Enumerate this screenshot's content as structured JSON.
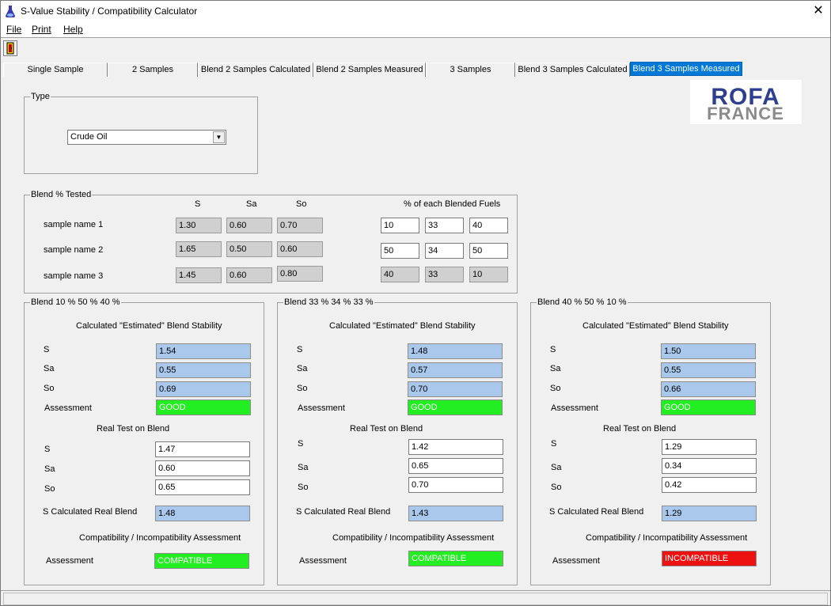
{
  "window": {
    "title": "S-Value Stability / Compatibility Calculator"
  },
  "menu": {
    "file": "File",
    "print": "Print",
    "help": "Help"
  },
  "tabs": [
    {
      "label": "Single Sample"
    },
    {
      "label": "2 Samples"
    },
    {
      "label": "Blend 2 Samples Calculated"
    },
    {
      "label": "Blend 2 Samples Measured"
    },
    {
      "label": "3 Samples"
    },
    {
      "label": "Blend 3 Samples Calculated"
    },
    {
      "label": "Blend 3 Samples Measured"
    }
  ],
  "logo": {
    "line1": "ROFA",
    "line2": "FRANCE"
  },
  "type_group": {
    "title": "Type",
    "selected": "Crude Oil"
  },
  "blend_tested": {
    "title": "Blend % Tested",
    "col_s": "S",
    "col_sa": "Sa",
    "col_so": "So",
    "fuels_header": "% of each Blended Fuels",
    "rows": [
      {
        "name": "sample name 1",
        "s": "1.30",
        "sa": "0.60",
        "so": "0.70",
        "p1": "10",
        "p2": "33",
        "p3": "40"
      },
      {
        "name": "sample name 2",
        "s": "1.65",
        "sa": "0.50",
        "so": "0.60",
        "p1": "50",
        "p2": "34",
        "p3": "50"
      },
      {
        "name": "sample name 3",
        "s": "1.45",
        "sa": "0.60",
        "so": "0.80",
        "p1": "40",
        "p2": "33",
        "p3": "10"
      }
    ]
  },
  "blends": [
    {
      "title": "Blend 10 % 50 % 40 %",
      "calc_header": "Calculated \"Estimated\" Blend Stability",
      "s_label": "S",
      "sa_label": "Sa",
      "so_label": "So",
      "assess_label": "Assessment",
      "calc_s": "1.54",
      "calc_sa": "0.55",
      "calc_so": "0.69",
      "calc_assessment": "GOOD",
      "real_header": "Real Test on Blend",
      "real_s": "1.47",
      "real_sa": "0.60",
      "real_so": "0.65",
      "s_calc_real_label": "S Calculated Real Blend",
      "s_calc_real": "1.48",
      "compat_header": "Compatibility / Incompatibility Assessment",
      "compat_assessment": "COMPATIBLE"
    },
    {
      "title": "Blend 33 % 34 % 33 %",
      "calc_header": "Calculated \"Estimated\" Blend Stability",
      "s_label": "S",
      "sa_label": "Sa",
      "so_label": "So",
      "assess_label": "Assessment",
      "calc_s": "1.48",
      "calc_sa": "0.57",
      "calc_so": "0.70",
      "calc_assessment": "GOOD",
      "real_header": "Real Test on Blend",
      "real_s": "1.42",
      "real_sa": "0.65",
      "real_so": "0.70",
      "s_calc_real_label": "S Calculated Real Blend",
      "s_calc_real": "1.43",
      "compat_header": "Compatibility / Incompatibility Assessment",
      "compat_assessment": "COMPATIBLE"
    },
    {
      "title": "Blend 40 % 50 % 10 %",
      "calc_header": "Calculated \"Estimated\" Blend Stability",
      "s_label": "S",
      "sa_label": "Sa",
      "so_label": "So",
      "assess_label": "Assessment",
      "calc_s": "1.50",
      "calc_sa": "0.55",
      "calc_so": "0.66",
      "calc_assessment": "GOOD",
      "real_header": "Real Test on Blend",
      "real_s": "1.29",
      "real_sa": "0.34",
      "real_so": "0.42",
      "s_calc_real_label": "S Calculated Real Blend",
      "s_calc_real": "1.29",
      "compat_header": "Compatibility / Incompatibility Assessment",
      "compat_assessment": "INCOMPATIBLE"
    }
  ],
  "colors": {
    "accent": "#0078d7",
    "good": "#22ee22",
    "bad": "#ee1111",
    "calc": "#a9c8ec",
    "logo_blue": "#2f3f8f"
  },
  "icons": {
    "app": "flask-icon",
    "tool": "exit-door-icon",
    "close": "close-icon",
    "dropdown": "chevron-down-icon"
  }
}
